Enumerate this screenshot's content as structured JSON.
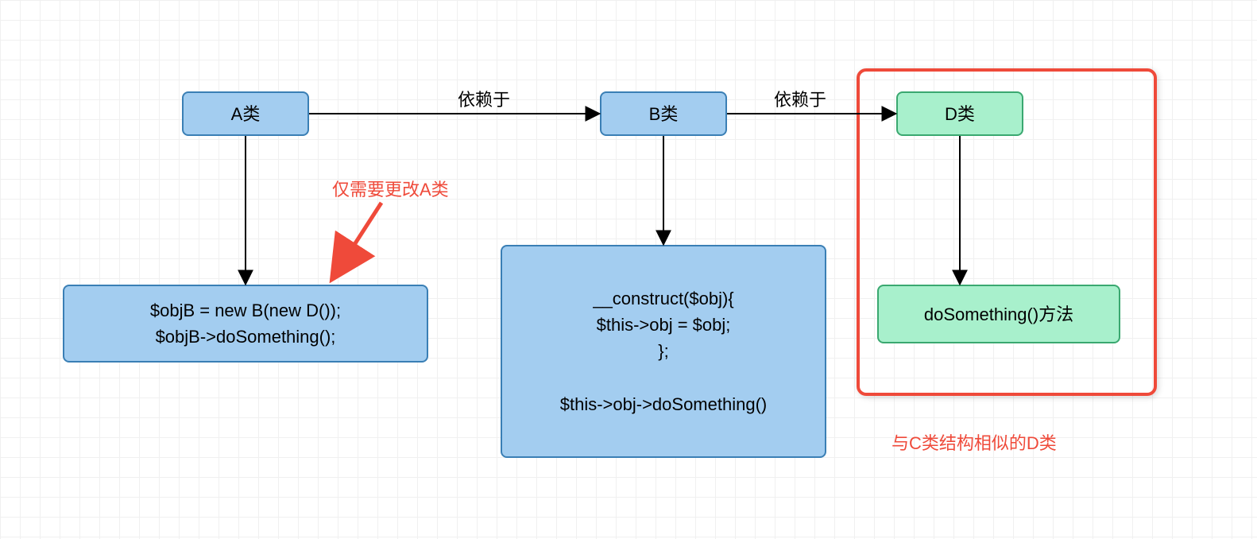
{
  "boxes": {
    "classA": {
      "title": "A类"
    },
    "classB": {
      "title": "B类"
    },
    "classD": {
      "title": "D类"
    },
    "codeA": {
      "line1": "$objB = new B(new D());",
      "line2": "$objB->doSomething();"
    },
    "codeB": {
      "line1": "__construct($obj){",
      "line2": "$this->obj = $obj;",
      "line3": "};",
      "line4": "$this->obj->doSomething()"
    },
    "codeD": {
      "line1": "doSomething()方法"
    }
  },
  "labels": {
    "depends1": "依赖于",
    "depends2": "依赖于",
    "noteA": "仅需要更改A类",
    "noteD": "与C类结构相似的D类"
  },
  "colors": {
    "blueFill": "#a3cdf0",
    "blueStroke": "#3a7fb5",
    "greenFill": "#a8f0cc",
    "greenStroke": "#3aa870",
    "red": "#ef4a3a"
  }
}
